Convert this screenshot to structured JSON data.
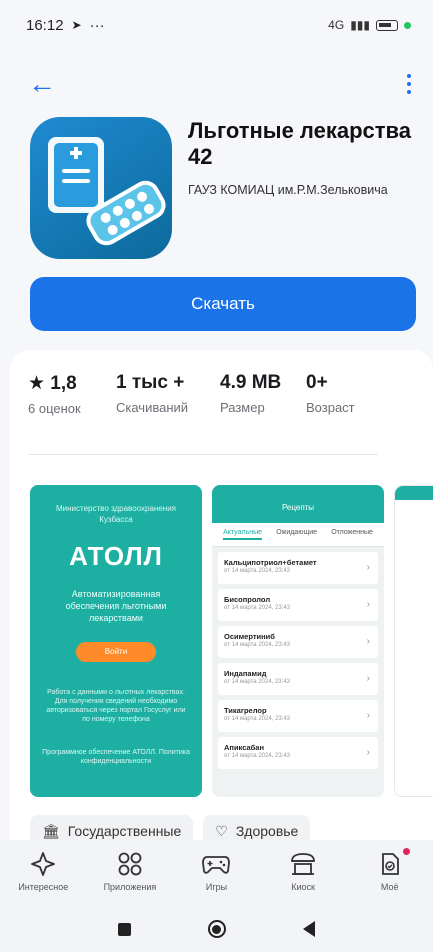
{
  "status_bar": {
    "time": "16:12",
    "extra": "···",
    "net_label": "4G"
  },
  "app": {
    "title": "Льготные лекарства 42",
    "developer": "ГАУЗ КОМИАЦ им.Р.М.Зельковича",
    "download_label": "Скачать"
  },
  "stats": [
    {
      "value": "★ 1,8",
      "label": "6 оценок"
    },
    {
      "value": "1 тыс +",
      "label": "Скачиваний"
    },
    {
      "value": "4.9 MB",
      "label": "Размер"
    },
    {
      "value": "0+",
      "label": "Возраст"
    }
  ],
  "screenshot1": {
    "org": "Министерство здравоохранения Кузбасса",
    "brand": "АТОЛЛ",
    "subtitle": "Автоматизированная обеспечения льготными лекарствами",
    "button": "Войти",
    "note1": "Работа с данными о льготных лекарствах. Для получения сведений необходимо авторизоваться через портал Госуслуг или по номеру телефона",
    "note2": "Программное обеспечение АТОЛЛ. Политика конфиденциальности"
  },
  "screenshot2": {
    "title": "Рецепты",
    "tabs": [
      "Актуальные",
      "Ожидающие",
      "Отложенные"
    ],
    "items": [
      {
        "name": "Кальципотриол+бетамет",
        "meta": "от 14 марта 2024, 23:43"
      },
      {
        "name": "Бисопролол",
        "meta": "от 14 марта 2024, 23:43"
      },
      {
        "name": "Осимертиниб",
        "meta": "от 14 марта 2024, 23:43"
      },
      {
        "name": "Индапамид",
        "meta": "от 14 марта 2024, 23:43"
      },
      {
        "name": "Тикагрелор",
        "meta": "от 14 марта 2024, 23:43"
      },
      {
        "name": "Апиксабан",
        "meta": "от 14 марта 2024, 23:43"
      }
    ]
  },
  "chips": [
    {
      "icon": "bank-icon",
      "label": "Государственные"
    },
    {
      "icon": "heart-icon",
      "label": "Здоровье"
    }
  ],
  "bottom_nav": [
    {
      "icon": "diamond-icon",
      "label": "Интересное"
    },
    {
      "icon": "apps-icon",
      "label": "Приложения"
    },
    {
      "icon": "gamepad-icon",
      "label": "Игры"
    },
    {
      "icon": "kiosk-icon",
      "label": "Киоск"
    },
    {
      "icon": "profile-icon",
      "label": "Моё"
    }
  ],
  "colors": {
    "accent": "#1a73e8",
    "teal": "#1eafa3",
    "orange": "#ff8a2a"
  }
}
